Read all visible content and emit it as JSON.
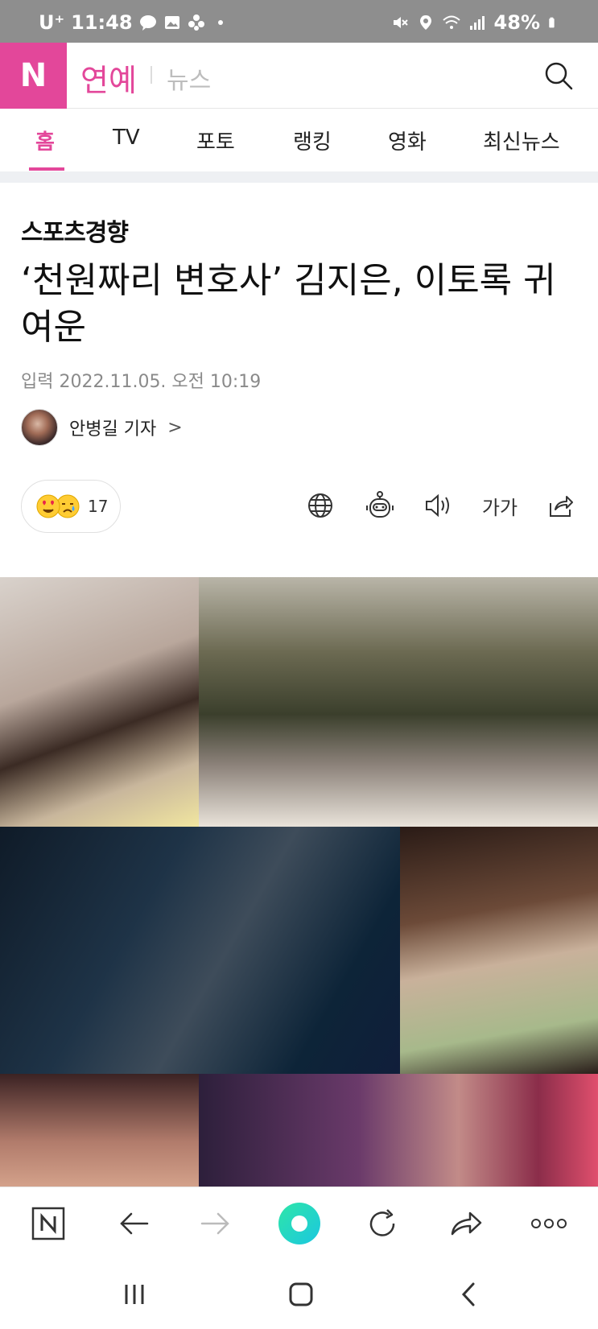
{
  "status_bar": {
    "carrier": "U⁺",
    "time": "11:48",
    "battery": "48%",
    "icons": [
      "talk-icon",
      "gallery-icon",
      "flower-icon",
      "dot-icon",
      "mute-icon",
      "location-icon",
      "wifi-icon",
      "signal-icon",
      "battery-icon"
    ]
  },
  "header": {
    "logo": "N",
    "section": "연예",
    "subsection": "뉴스",
    "search_icon": "search-icon",
    "accent_color": "#e3479a"
  },
  "tabs": [
    {
      "label": "홈",
      "active": true
    },
    {
      "label": "TV",
      "active": false
    },
    {
      "label": "포토",
      "active": false
    },
    {
      "label": "랭킹",
      "active": false
    },
    {
      "label": "영화",
      "active": false
    },
    {
      "label": "최신뉴스",
      "active": false
    }
  ],
  "article": {
    "press": "스포츠경향",
    "title": "‘천원짜리 변호사’ 김지은, 이토록 귀여운",
    "date": "입력 2022.11.05. 오전 10:19",
    "reporter": "안병길 기자",
    "reporter_arrow": ">",
    "reaction_count": "17",
    "font_tool_label": "가가",
    "tools": [
      "globe-icon",
      "robot-icon",
      "speaker-icon",
      "font-size-icon",
      "share-icon"
    ]
  },
  "browser_bar": {
    "icons": [
      "naver-home-icon",
      "back-icon",
      "forward-icon",
      "green-dot-icon",
      "refresh-icon",
      "share-arrow-icon",
      "more-icon"
    ]
  },
  "system_nav": {
    "icons": [
      "recent-apps-icon",
      "home-icon",
      "back-nav-icon"
    ]
  }
}
